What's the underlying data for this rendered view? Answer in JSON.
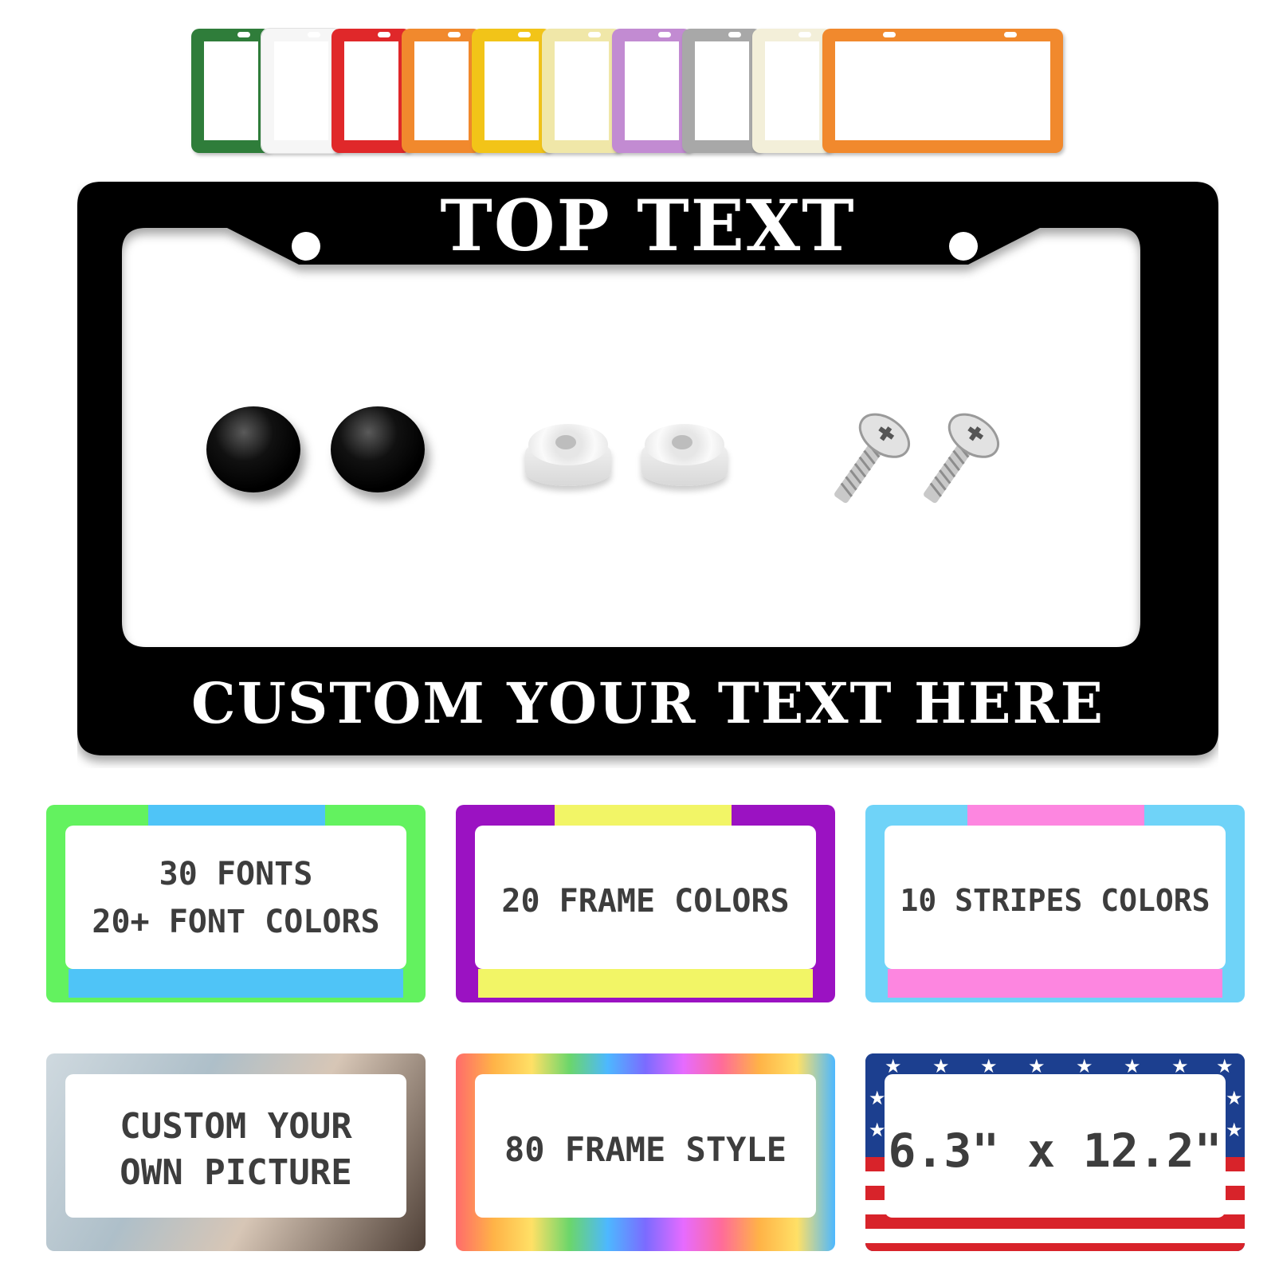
{
  "swatches": {
    "colors": [
      "#2f7d3a",
      "#ffffff",
      "#e0282a",
      "#f1892d",
      "#f2c418",
      "#f0e7a8",
      "#c28bd2",
      "#a8a8a8",
      "#f3efd9"
    ],
    "last_color": "#f1892d"
  },
  "main_frame": {
    "frame_color": "#000000",
    "top_text": "TOP TEXT",
    "bottom_text": "CUSTOM YOUR TEXT HERE",
    "hardware": [
      "screw-cap",
      "screw-cap",
      "washer",
      "washer",
      "screw",
      "screw"
    ]
  },
  "cards": [
    {
      "id": "fonts",
      "frame_color": "#63f25f",
      "stripe_color": "#4fc4f7",
      "lines": [
        "30 FONTS",
        "20+ FONT COLORS"
      ]
    },
    {
      "id": "frame-colors",
      "frame_color": "#9b12c2",
      "stripe_color": "#f2f566",
      "lines": [
        "20 FRAME COLORS"
      ]
    },
    {
      "id": "stripes-colors",
      "frame_color": "#6fd3f8",
      "stripe_color": "#fd86e0",
      "lines": [
        "10 STRIPES COLORS"
      ]
    },
    {
      "id": "picture",
      "frame_style": "photo",
      "lines": [
        "CUSTOM YOUR",
        "OWN PICTURE"
      ]
    },
    {
      "id": "frame-style",
      "frame_style": "watercolor",
      "lines": [
        "80 FRAME STYLE"
      ]
    },
    {
      "id": "size",
      "frame_style": "us-flag",
      "lines": [
        "6.3\" x 12.2\""
      ]
    }
  ]
}
